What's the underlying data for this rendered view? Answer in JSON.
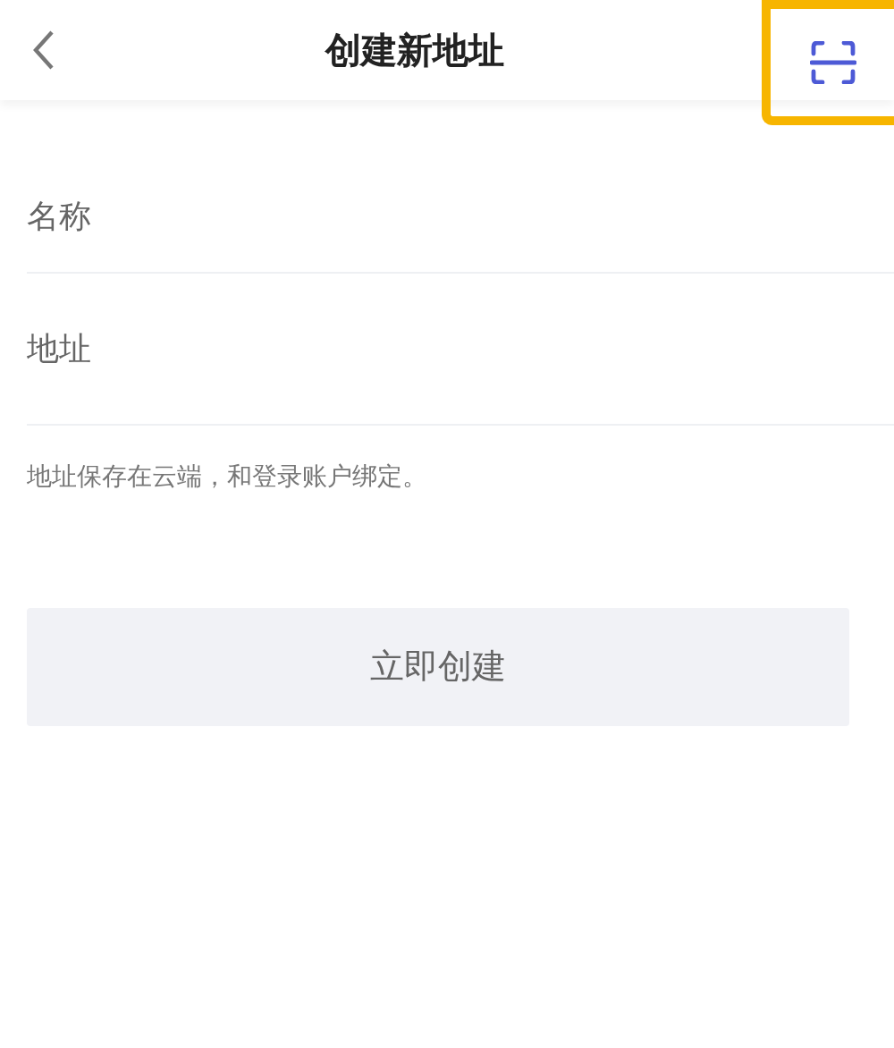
{
  "header": {
    "title": "创建新地址",
    "scan_button": {
      "highlighted": true
    }
  },
  "fields": [
    {
      "placeholder": "名称"
    },
    {
      "placeholder": "地址"
    }
  ],
  "note": "地址保存在云端，和登录账户绑定。",
  "submit": {
    "label": "立即创建",
    "disabled": true
  }
}
